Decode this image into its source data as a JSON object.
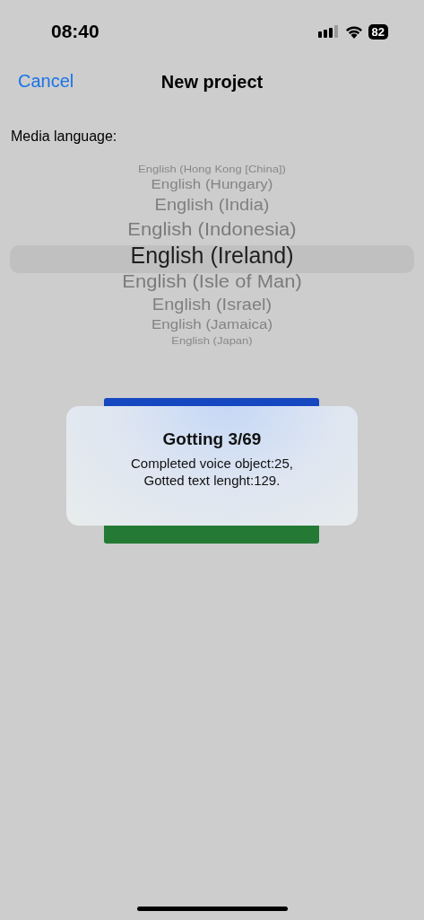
{
  "status_bar": {
    "time": "08:40",
    "battery": "82"
  },
  "nav": {
    "cancel": "Cancel",
    "title": "New project"
  },
  "media_language": {
    "label": "Media language:"
  },
  "picker": [
    {
      "label": "English (Hong Kong [China])",
      "selected": false
    },
    {
      "label": "English (Hungary)",
      "selected": false
    },
    {
      "label": "English (India)",
      "selected": false
    },
    {
      "label": "English (Indonesia)",
      "selected": false
    },
    {
      "label": "English (Ireland)",
      "selected": true
    },
    {
      "label": "English (Isle of Man)",
      "selected": false
    },
    {
      "label": "English (Israel)",
      "selected": false
    },
    {
      "label": "English (Jamaica)",
      "selected": false
    },
    {
      "label": "English (Japan)",
      "selected": false
    }
  ],
  "progress_dialog": {
    "title": "Gotting 3/69",
    "lines": [
      "Completed voice object:25,",
      "Gotted text lenght:129."
    ]
  }
}
